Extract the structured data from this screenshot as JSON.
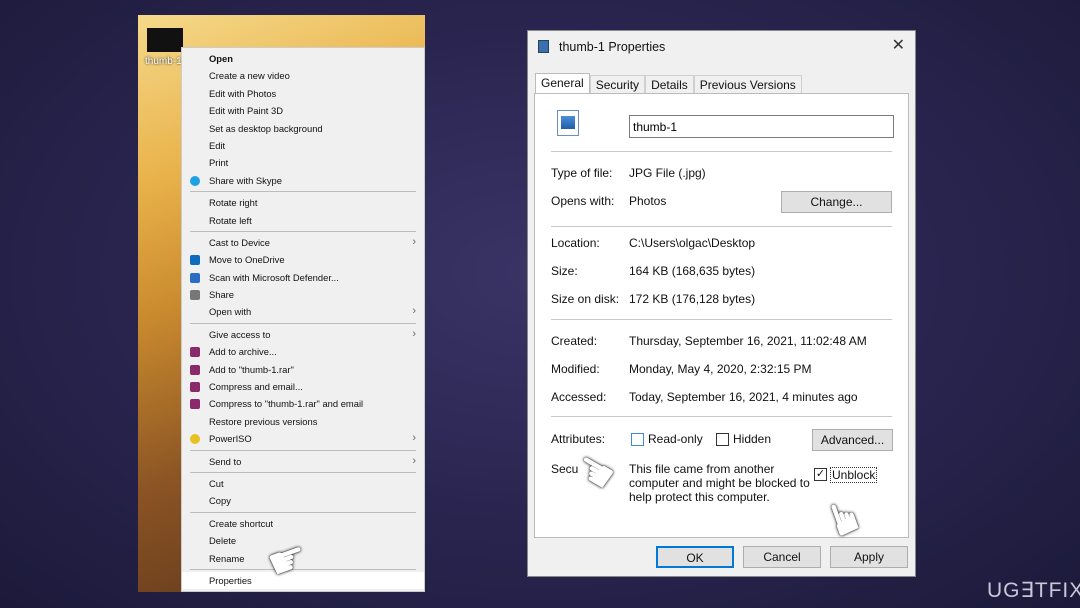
{
  "desktop": {
    "file_label": "thumb-1"
  },
  "context_menu": {
    "items": [
      {
        "label": "Open",
        "bold": true
      },
      {
        "label": "Create a new video"
      },
      {
        "label": "Edit with Photos"
      },
      {
        "label": "Edit with Paint 3D"
      },
      {
        "label": "Set as desktop background"
      },
      {
        "label": "Edit"
      },
      {
        "label": "Print"
      },
      {
        "label": "Share with Skype",
        "icon": "skype-icon",
        "color": "#1da1e4"
      },
      {
        "sep": true
      },
      {
        "label": "Rotate right"
      },
      {
        "label": "Rotate left"
      },
      {
        "sep": true
      },
      {
        "label": "Cast to Device",
        "submenu": true
      },
      {
        "label": "Move to OneDrive",
        "icon": "onedrive-icon",
        "color": "#0f6cbd"
      },
      {
        "label": "Scan with Microsoft Defender...",
        "icon": "defender-icon",
        "color": "#2b6cc4"
      },
      {
        "label": "Share",
        "icon": "share-icon",
        "color": "#777"
      },
      {
        "label": "Open with",
        "submenu": true
      },
      {
        "sep": true
      },
      {
        "label": "Give access to",
        "submenu": true
      },
      {
        "label": "Add to archive...",
        "icon": "winrar-icon",
        "color": "#8a2a6a"
      },
      {
        "label": "Add to \"thumb-1.rar\"",
        "icon": "winrar-icon",
        "color": "#8a2a6a"
      },
      {
        "label": "Compress and email...",
        "icon": "winrar-icon",
        "color": "#8a2a6a"
      },
      {
        "label": "Compress to \"thumb-1.rar\" and email",
        "icon": "winrar-icon",
        "color": "#8a2a6a"
      },
      {
        "label": "Restore previous versions"
      },
      {
        "label": "PowerISO",
        "icon": "poweriso-icon",
        "color": "#e8c020",
        "submenu": true
      },
      {
        "sep": true
      },
      {
        "label": "Send to",
        "submenu": true
      },
      {
        "sep": true
      },
      {
        "label": "Cut"
      },
      {
        "label": "Copy"
      },
      {
        "sep": true
      },
      {
        "label": "Create shortcut"
      },
      {
        "label": "Delete"
      },
      {
        "label": "Rename"
      },
      {
        "sep": true
      },
      {
        "label": "Properties",
        "highlighted": true
      }
    ]
  },
  "dialog": {
    "title": "thumb-1 Properties",
    "tabs": [
      "General",
      "Security",
      "Details",
      "Previous Versions"
    ],
    "active_tab": "General",
    "name_value": "thumb-1",
    "type_label": "Type of file:",
    "type_value": "JPG File (.jpg)",
    "opens_label": "Opens with:",
    "opens_value": "Photos",
    "change_button": "Change...",
    "location_label": "Location:",
    "location_value": "C:\\Users\\olgac\\Desktop",
    "size_label": "Size:",
    "size_value": "164 KB (168,635 bytes)",
    "size_disk_label": "Size on disk:",
    "size_disk_value": "172 KB (176,128 bytes)",
    "created_label": "Created:",
    "created_value": "Thursday, September 16, 2021, 11:02:48 AM",
    "modified_label": "Modified:",
    "modified_value": "Monday, May 4, 2020, 2:32:15 PM",
    "accessed_label": "Accessed:",
    "accessed_value": "Today, September 16, 2021, 4 minutes ago",
    "attributes_label": "Attributes:",
    "readonly_label": "Read-only",
    "readonly_checked": false,
    "hidden_label": "Hidden",
    "hidden_checked": false,
    "advanced_button": "Advanced...",
    "security_label": "Secu",
    "security_text": "This file came from another computer and might be blocked to help protect this computer.",
    "unblock_label": "Unblock",
    "unblock_checked": true,
    "ok": "OK",
    "cancel": "Cancel",
    "apply": "Apply"
  },
  "watermark": "UG∃TFIX"
}
